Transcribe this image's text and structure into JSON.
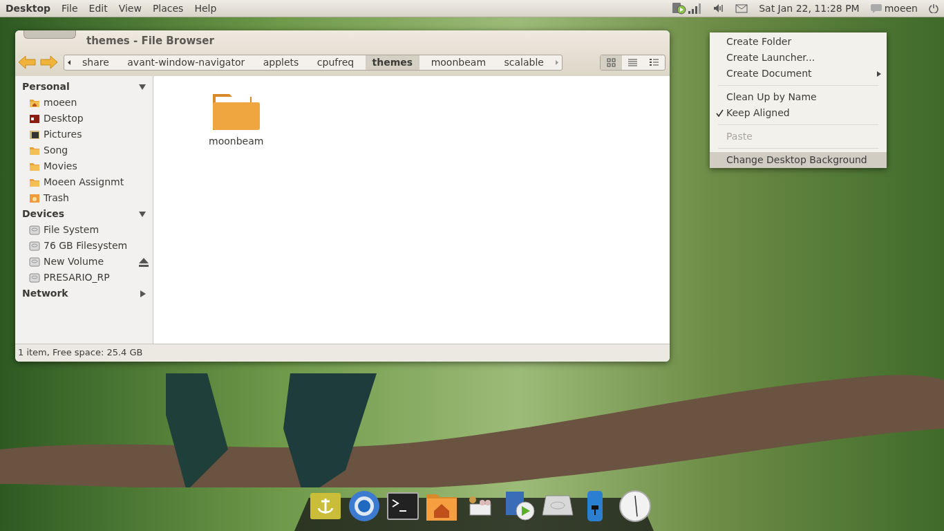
{
  "top_panel": {
    "app_name": "Desktop",
    "menus": [
      "File",
      "Edit",
      "View",
      "Places",
      "Help"
    ],
    "clock": "Sat Jan 22, 11:28 PM",
    "user": "moeen"
  },
  "window": {
    "title": "themes - File Browser",
    "path": [
      {
        "label": "share",
        "selected": false
      },
      {
        "label": "avant-window-navigator",
        "selected": false
      },
      {
        "label": "applets",
        "selected": false
      },
      {
        "label": "cpufreq",
        "selected": false
      },
      {
        "label": "themes",
        "selected": true
      },
      {
        "label": "moonbeam",
        "selected": false
      },
      {
        "label": "scalable",
        "selected": false
      }
    ],
    "views": [
      {
        "kind": "icons",
        "selected": true
      },
      {
        "kind": "list",
        "selected": false
      },
      {
        "kind": "compact",
        "selected": false
      }
    ],
    "sidebar": [
      {
        "heading": "Personal",
        "expanded": true,
        "items": [
          {
            "label": "moeen",
            "kind": "home",
            "eject": false
          },
          {
            "label": "Desktop",
            "kind": "desktop",
            "eject": false
          },
          {
            "label": "Pictures",
            "kind": "pictures",
            "eject": false
          },
          {
            "label": "Song",
            "kind": "folder",
            "eject": false
          },
          {
            "label": "Movies",
            "kind": "folder",
            "eject": false
          },
          {
            "label": "Moeen Assignmt",
            "kind": "folder",
            "eject": false
          },
          {
            "label": "Trash",
            "kind": "trash",
            "eject": false
          }
        ]
      },
      {
        "heading": "Devices",
        "expanded": true,
        "items": [
          {
            "label": "File System",
            "kind": "drive",
            "eject": false
          },
          {
            "label": "76 GB Filesystem",
            "kind": "drive",
            "eject": false
          },
          {
            "label": "New Volume",
            "kind": "drive",
            "eject": true
          },
          {
            "label": "PRESARIO_RP",
            "kind": "drive",
            "eject": false
          }
        ]
      },
      {
        "heading": "Network",
        "expanded": false
      }
    ],
    "files": [
      {
        "name": "moonbeam"
      }
    ],
    "status": "1 item, Free space: 25.4 GB"
  },
  "context_menu": {
    "items": [
      {
        "kind": "item",
        "label": "Create Folder",
        "checked": false,
        "disabled": false,
        "submenu": false,
        "selected": false
      },
      {
        "kind": "item",
        "label": "Create Launcher...",
        "checked": false,
        "disabled": false,
        "submenu": false,
        "selected": false
      },
      {
        "kind": "item",
        "label": "Create Document",
        "checked": false,
        "disabled": false,
        "submenu": true,
        "selected": false
      },
      {
        "kind": "separator"
      },
      {
        "kind": "item",
        "label": "Clean Up by Name",
        "checked": false,
        "disabled": false,
        "submenu": false,
        "selected": false
      },
      {
        "kind": "item",
        "label": "Keep Aligned",
        "checked": true,
        "disabled": false,
        "submenu": false,
        "selected": false
      },
      {
        "kind": "separator"
      },
      {
        "kind": "item",
        "label": "Paste",
        "checked": false,
        "disabled": true,
        "submenu": false,
        "selected": false
      },
      {
        "kind": "separator"
      },
      {
        "kind": "item",
        "label": "Change Desktop Background",
        "checked": false,
        "disabled": false,
        "submenu": false,
        "selected": true
      }
    ]
  },
  "dock": {
    "items": [
      {
        "kind": "anchor"
      },
      {
        "kind": "browser"
      },
      {
        "kind": "terminal"
      },
      {
        "kind": "home"
      },
      {
        "kind": "people"
      },
      {
        "kind": "video"
      },
      {
        "kind": "disk"
      },
      {
        "kind": "battery"
      },
      {
        "kind": "clock"
      }
    ]
  }
}
